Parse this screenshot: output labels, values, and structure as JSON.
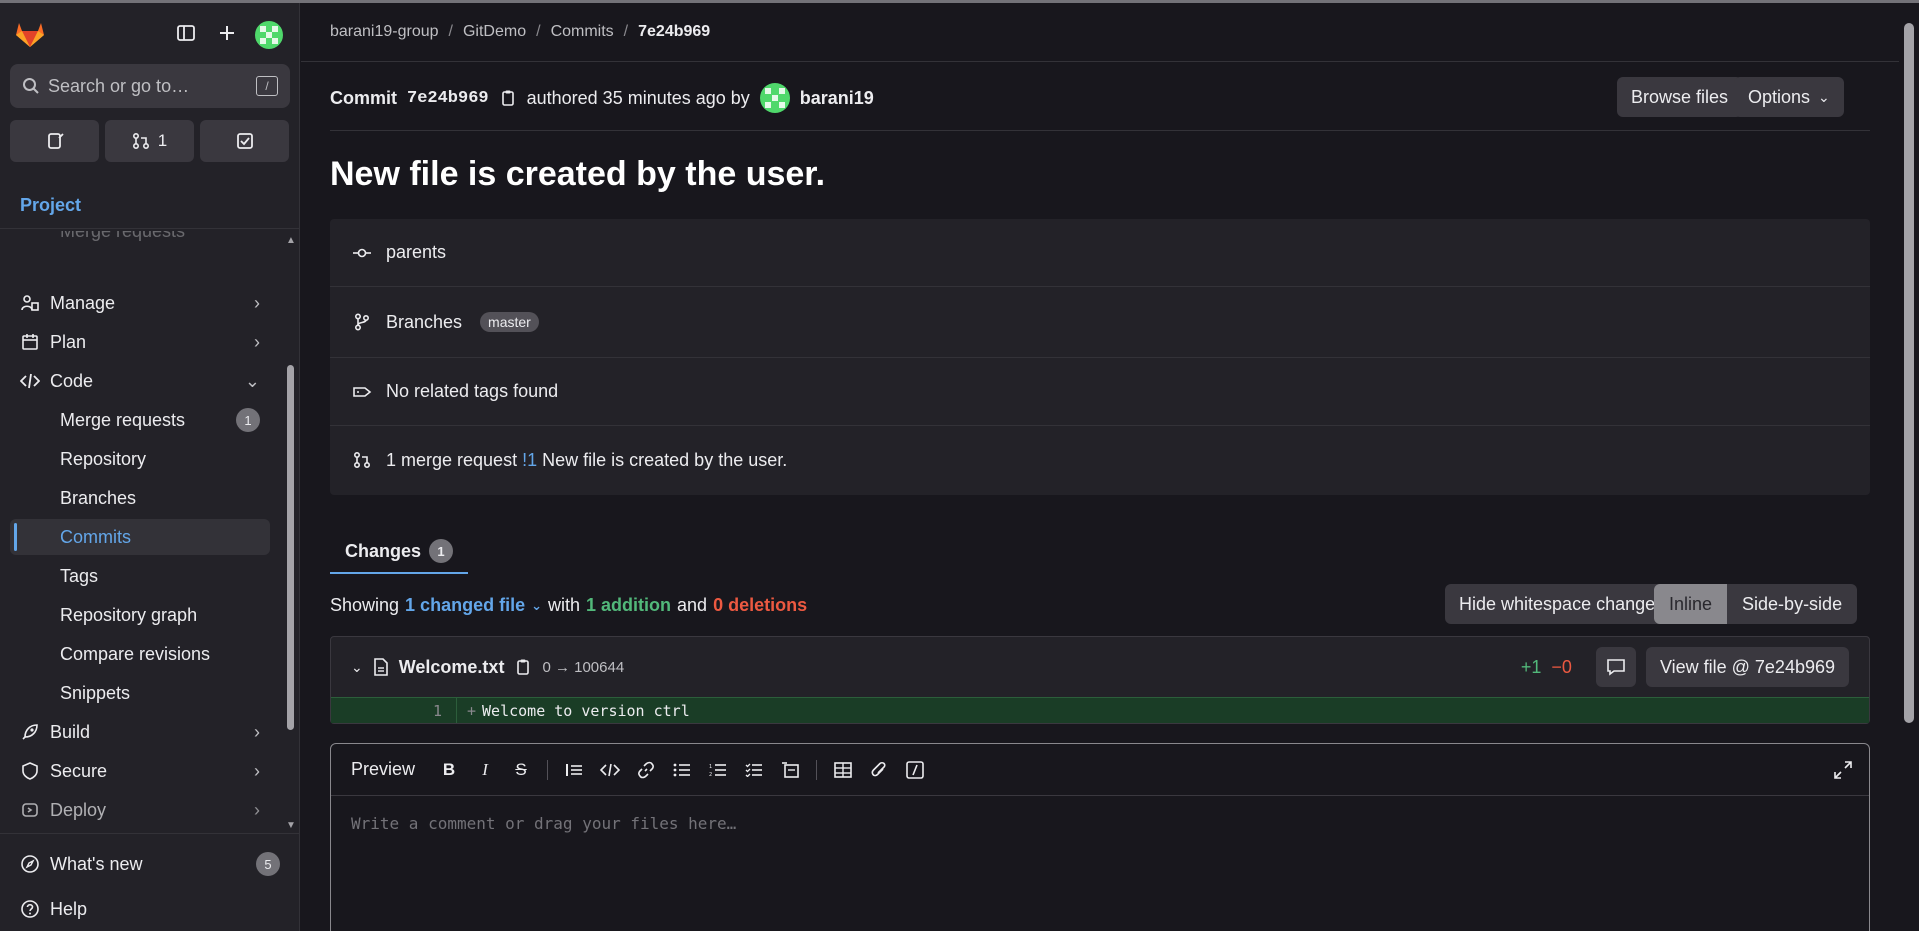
{
  "sidebar": {
    "search_placeholder": "Search or go to…",
    "search_kbd": "/",
    "quick": {
      "mr_count": "1"
    },
    "section_label": "Project",
    "partial_item": "Merge requests",
    "items": [
      {
        "label": "Manage",
        "icon": "manage-icon"
      },
      {
        "label": "Plan",
        "icon": "plan-icon"
      },
      {
        "label": "Code",
        "icon": "code-icon"
      }
    ],
    "code_sub": [
      {
        "label": "Merge requests",
        "badge": "1"
      },
      {
        "label": "Repository"
      },
      {
        "label": "Branches"
      },
      {
        "label": "Commits",
        "active": true
      },
      {
        "label": "Tags"
      },
      {
        "label": "Repository graph"
      },
      {
        "label": "Compare revisions"
      },
      {
        "label": "Snippets"
      }
    ],
    "items_after": [
      {
        "label": "Build",
        "icon": "rocket-icon"
      },
      {
        "label": "Secure",
        "icon": "shield-icon"
      },
      {
        "label": "Deploy",
        "icon": "deploy-icon"
      }
    ],
    "bottom": {
      "whats_new": "What's new",
      "whats_new_badge": "5",
      "help": "Help"
    }
  },
  "breadcrumb": [
    "barani19-group",
    "GitDemo",
    "Commits",
    "7e24b969"
  ],
  "commit": {
    "label": "Commit",
    "sha": "7e24b969",
    "authored": "authored 35 minutes ago by",
    "author": "barani19",
    "title": "New file is created by the user.",
    "browse_files": "Browse files",
    "options": "Options"
  },
  "info": {
    "parents": "parents",
    "branches_label": "Branches",
    "branch": "master",
    "tags": "No related tags found",
    "mr_prefix": "1 merge request",
    "mr_ref": "!1",
    "mr_title": "New file is created by the user."
  },
  "changes": {
    "tab_label": "Changes",
    "tab_count": "1",
    "showing": "Showing",
    "changed_files": "1 changed file",
    "with": "with",
    "additions": "1 addition",
    "and": "and",
    "deletions": "0 deletions",
    "hide_ws": "Hide whitespace changes",
    "inline": "Inline",
    "side_by_side": "Side-by-side"
  },
  "file": {
    "name": "Welcome.txt",
    "mode": "0 → 100644",
    "added": "+1",
    "removed": "−0",
    "view_file": "View file @ 7e24b969",
    "line_num": "1",
    "line_code": "Welcome to version ctrl"
  },
  "editor": {
    "preview": "Preview",
    "placeholder": "Write a comment or drag your files here…"
  }
}
